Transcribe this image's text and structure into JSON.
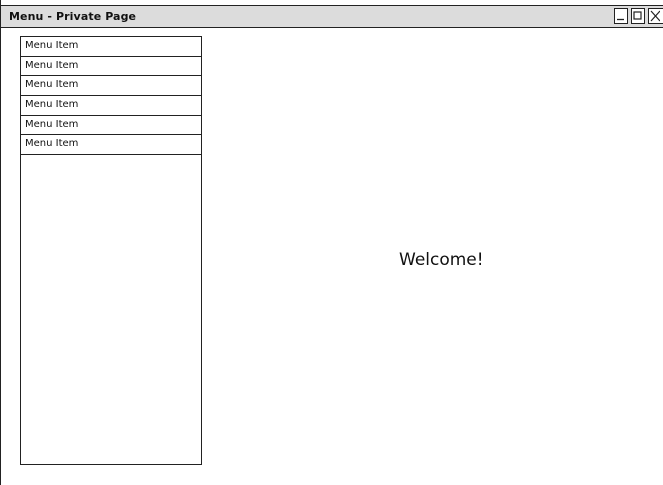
{
  "window": {
    "title": "Menu - Private Page",
    "controls": {
      "minimize_icon": "minimize-icon",
      "maximize_icon": "maximize-icon",
      "close_icon": "close-icon"
    }
  },
  "sidebar": {
    "items": [
      {
        "label": "Menu Item"
      },
      {
        "label": "Menu Item"
      },
      {
        "label": "Menu Item"
      },
      {
        "label": "Menu Item"
      },
      {
        "label": "Menu Item"
      },
      {
        "label": "Menu Item"
      }
    ]
  },
  "main": {
    "welcome": "Welcome!"
  },
  "colors": {
    "titlebar": "#dcdcdc",
    "border": "#222222",
    "background": "#ffffff"
  }
}
